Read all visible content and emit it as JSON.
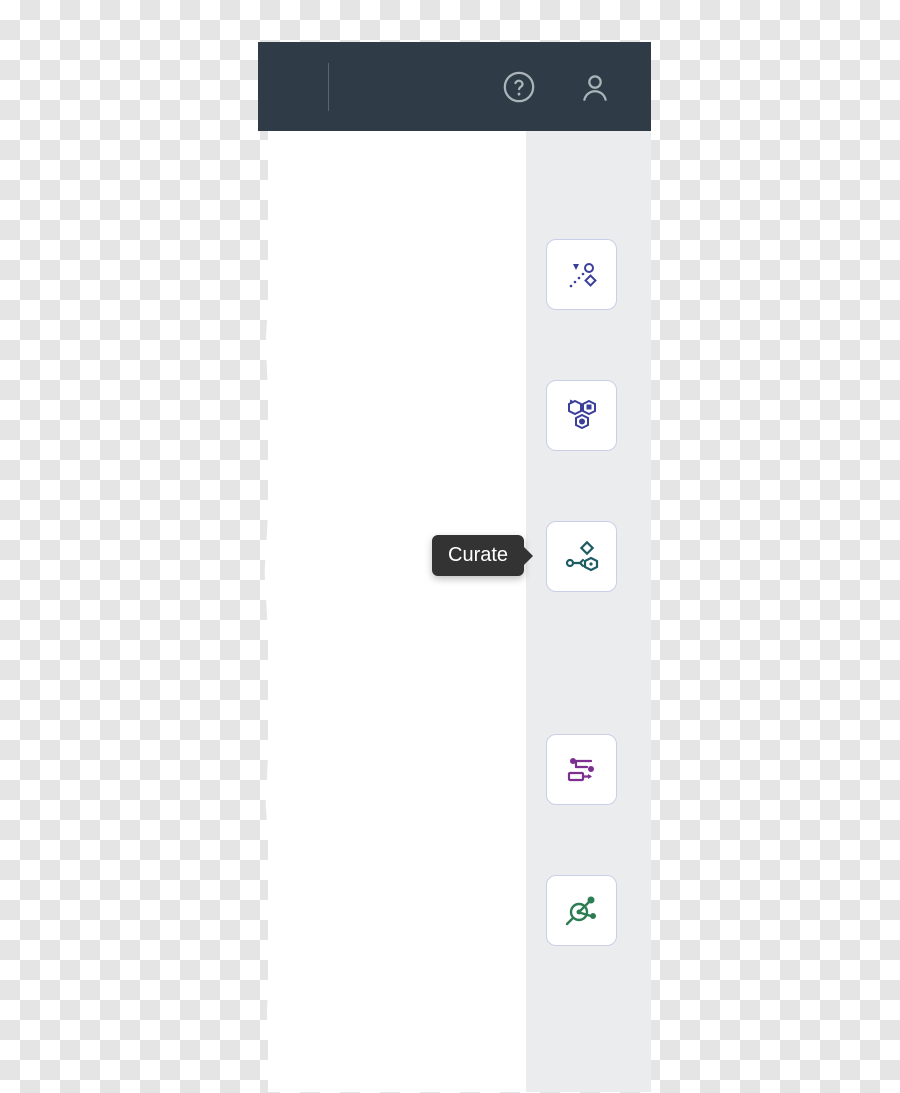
{
  "header": {
    "help_icon": "help-icon",
    "user_icon": "user-icon"
  },
  "right_rail": {
    "tiles": [
      {
        "name": "load",
        "color": "#3a3f99"
      },
      {
        "name": "model",
        "color": "#3a3f99"
      },
      {
        "name": "curate",
        "color": "#1e5b63"
      },
      {
        "name": "run",
        "color": "#7b2f8f"
      },
      {
        "name": "explore",
        "color": "#2d7d52"
      }
    ]
  },
  "tooltip": {
    "curate": "Curate"
  }
}
